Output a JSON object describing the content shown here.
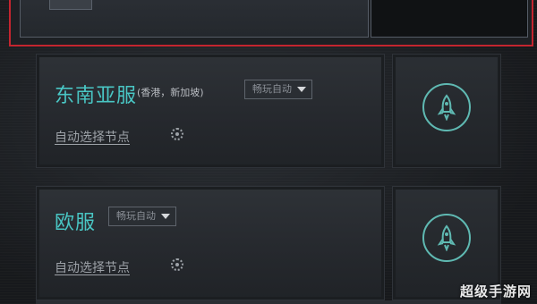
{
  "servers": [
    {
      "name": "东南亚服",
      "extra": "(香港，新加坡)",
      "mode": "畅玩自动",
      "auto_node": "自动选择节点"
    },
    {
      "name": "欧服",
      "extra": "",
      "mode": "畅玩自动",
      "auto_node": "自动选择节点"
    }
  ],
  "icons": {
    "launch": "rocket-icon",
    "settings": "gear-icon",
    "dropdown": "chevron-down-icon"
  },
  "colors": {
    "selected_border": "#c4252f",
    "region_text": "#49c6c4",
    "rocket": "#5fb9b2"
  },
  "watermark": "超级手游网"
}
